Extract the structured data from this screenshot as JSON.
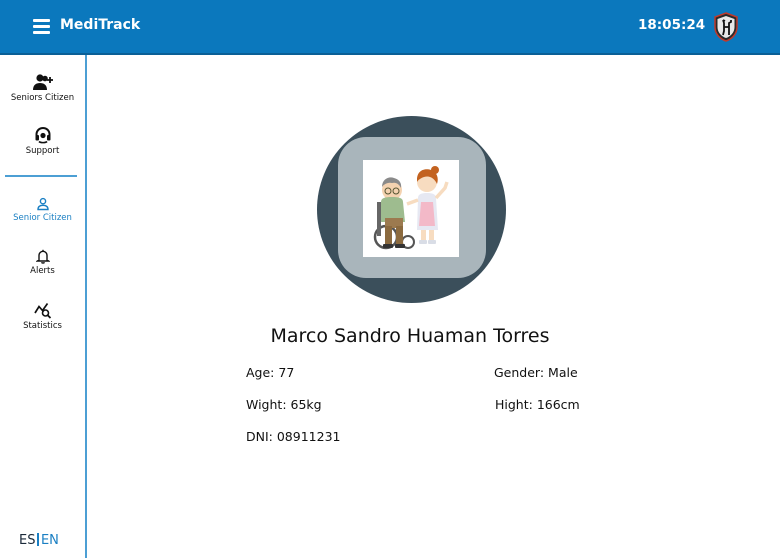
{
  "header": {
    "title": "MediTrack",
    "clock": "18:05:24"
  },
  "sidebar": {
    "items": [
      {
        "label": "Seniors Citizen",
        "icon": "add-users-icon"
      },
      {
        "label": "Support",
        "icon": "headset-icon"
      },
      {
        "label": "Senior Citizen",
        "icon": "user-icon",
        "active": true
      },
      {
        "label": "Alerts",
        "icon": "bell-icon"
      },
      {
        "label": "Statistics",
        "icon": "chart-search-icon"
      }
    ],
    "language": {
      "es": "ES",
      "en": "EN",
      "selected": "EN"
    }
  },
  "profile": {
    "name": "Marco Sandro Huaman Torres",
    "age": "Age: 77",
    "gender": "Gender: Male",
    "weight": "Wight: 65kg",
    "height": "Hight: 166cm",
    "dni": "DNI: 08911231"
  },
  "colors": {
    "header_bg": "#0b78bd",
    "accent": "#1a7fc3",
    "avatar_ring": "#3b4f5b",
    "avatar_inner": "#a9b5bb"
  }
}
